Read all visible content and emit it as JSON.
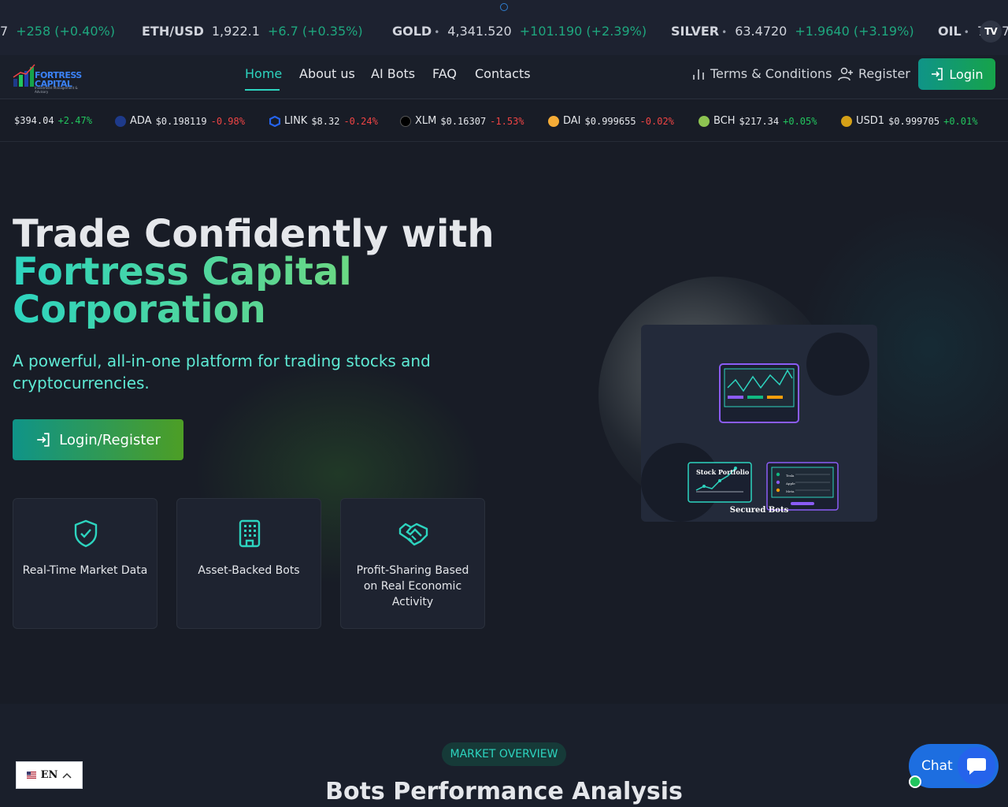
{
  "top_ticker": {
    "items": [
      {
        "symbol": "",
        "price": "7",
        "change": "+258 (+0.40%)"
      },
      {
        "symbol": "ETH/USD",
        "price": "1,922.1",
        "change": "+6.7 (+0.35%)"
      },
      {
        "symbol": "GOLD",
        "price": "4,341.520",
        "change": "+101.190 (+2.39%)"
      },
      {
        "symbol": "SILVER",
        "price": "63.4720",
        "change": "+1.9640 (+3.19%)"
      },
      {
        "symbol": "OIL",
        "price": "7",
        "change": ""
      }
    ],
    "tail_price": "7",
    "logo_text": "TV"
  },
  "nav": {
    "logo_title": "FORTRESS CAPITAL",
    "logo_subtitle": "Investment Management & Advisory",
    "links": [
      "Home",
      "About us",
      "AI Bots",
      "FAQ",
      "Contacts"
    ],
    "terms": "Terms & Conditions",
    "register": "Register",
    "login": "Login"
  },
  "crypto_ticker": [
    {
      "name": "",
      "price": "$394.04",
      "change": "+2.47%",
      "dir": "up",
      "color": "#f59e0b"
    },
    {
      "name": "ADA",
      "price": "$0.198119",
      "change": "-0.98%",
      "dir": "dn",
      "color": "#1e3a8a"
    },
    {
      "name": "LINK",
      "price": "$8.32",
      "change": "-0.24%",
      "dir": "dn",
      "color": "#2563eb"
    },
    {
      "name": "XLM",
      "price": "$0.16307",
      "change": "-1.53%",
      "dir": "dn",
      "color": "#000000"
    },
    {
      "name": "DAI",
      "price": "$0.999655",
      "change": "-0.02%",
      "dir": "dn",
      "color": "#f5ac37"
    },
    {
      "name": "BCH",
      "price": "$217.34",
      "change": "+0.05%",
      "dir": "up",
      "color": "#8dc351"
    },
    {
      "name": "USD1",
      "price": "$0.999705",
      "change": "+0.01%",
      "dir": "up",
      "color": "#d4a017"
    }
  ],
  "hero": {
    "title_line1": "Trade Confidently with",
    "title_line2": "Fortress Capital",
    "title_line3": "Corporation",
    "subtitle": "A powerful, all-in-one platform for trading stocks and cryptocurrencies.",
    "cta": "Login/Register",
    "features": [
      {
        "icon": "shield-check-icon",
        "text": "Real-Time Market Data"
      },
      {
        "icon": "building-icon",
        "text": "Asset-Backed Bots"
      },
      {
        "icon": "handshake-icon",
        "text": "Profit-Sharing Based on Real Economic Activity"
      }
    ],
    "illustration": {
      "card_title": "Stock Portfolio",
      "caption": "Secured Bots",
      "legend": [
        "Tesla",
        "Apple",
        "Meta"
      ]
    }
  },
  "market": {
    "badge": "MARKET OVERVIEW",
    "title": "Bots Performance Analysis"
  },
  "language": {
    "code": "EN"
  },
  "chat": {
    "label": "Chat"
  },
  "colors": {
    "accent": "#2dd4bf",
    "up": "#22c55e",
    "down": "#ef4444",
    "chat": "#1d6ee0"
  }
}
